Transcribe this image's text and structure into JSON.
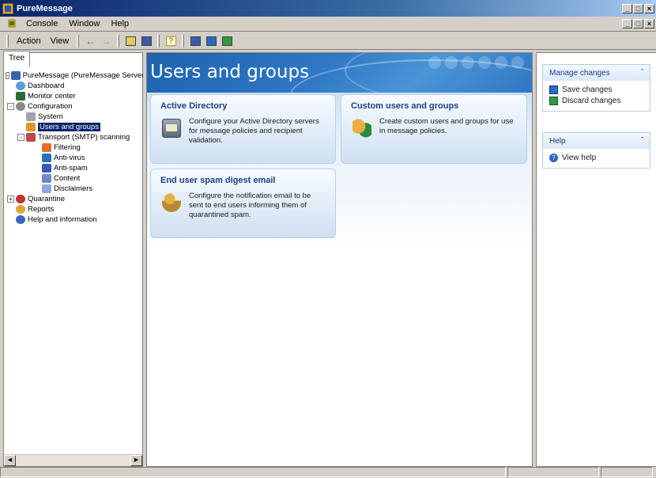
{
  "window": {
    "title": "PureMessage",
    "min": "_",
    "max": "□",
    "close": "×"
  },
  "menubar": {
    "items": [
      "Console",
      "Window",
      "Help"
    ]
  },
  "toolbar": {
    "action_label": "Action",
    "view_label": "View"
  },
  "tree": {
    "tab_label": "Tree",
    "nodes": [
      {
        "label": "PureMessage (PureMessage Server)",
        "icon": "server-icon",
        "level": 0,
        "expander": "-"
      },
      {
        "label": "Dashboard",
        "icon": "dashboard-icon",
        "level": 1,
        "expander": ""
      },
      {
        "label": "Monitor center",
        "icon": "monitor-icon",
        "level": 1,
        "expander": ""
      },
      {
        "label": "Configuration",
        "icon": "configuration-icon",
        "level": 1,
        "expander": "-"
      },
      {
        "label": "System",
        "icon": "system-icon",
        "level": 2,
        "expander": ""
      },
      {
        "label": "Users and groups",
        "icon": "users-icon",
        "level": 2,
        "expander": "",
        "selected": true
      },
      {
        "label": "Transport (SMTP) scanning",
        "icon": "shield-icon",
        "level": 2,
        "expander": "-"
      },
      {
        "label": "Filtering",
        "icon": "filter-icon",
        "level": 3,
        "expander": ""
      },
      {
        "label": "Anti-virus",
        "icon": "antivirus-icon",
        "level": 3,
        "expander": ""
      },
      {
        "label": "Anti-spam",
        "icon": "antispam-icon",
        "level": 3,
        "expander": ""
      },
      {
        "label": "Content",
        "icon": "content-icon",
        "level": 3,
        "expander": ""
      },
      {
        "label": "Disclaimers",
        "icon": "disclaimer-icon",
        "level": 3,
        "expander": ""
      },
      {
        "label": "Quarantine",
        "icon": "quarantine-icon",
        "level": 1,
        "expander": "+"
      },
      {
        "label": "Reports",
        "icon": "reports-icon",
        "level": 1,
        "expander": ""
      },
      {
        "label": "Help and information",
        "icon": "help-icon",
        "level": 1,
        "expander": ""
      }
    ]
  },
  "main": {
    "title": "Users and groups",
    "cards": [
      {
        "title": "Active Directory",
        "desc": "Configure your Active Directory servers for message policies and recipient validation.",
        "icon": "active-directory-icon"
      },
      {
        "title": "Custom users and groups",
        "desc": "Create custom users and groups for use in message policies.",
        "icon": "users-groups-icon"
      },
      {
        "title": "End user spam digest email",
        "desc": "Configure the notification email to be sent to end users informing them of quarantined spam.",
        "icon": "spam-digest-icon"
      }
    ]
  },
  "actions": {
    "manage_title": "Manage changes",
    "save_label": "Save changes",
    "discard_label": "Discard changes",
    "help_title": "Help",
    "help_label": "View help"
  },
  "colors": {
    "accent": "#1f62ae",
    "card_title": "#1c3d8a",
    "selection": "#0a246a"
  }
}
